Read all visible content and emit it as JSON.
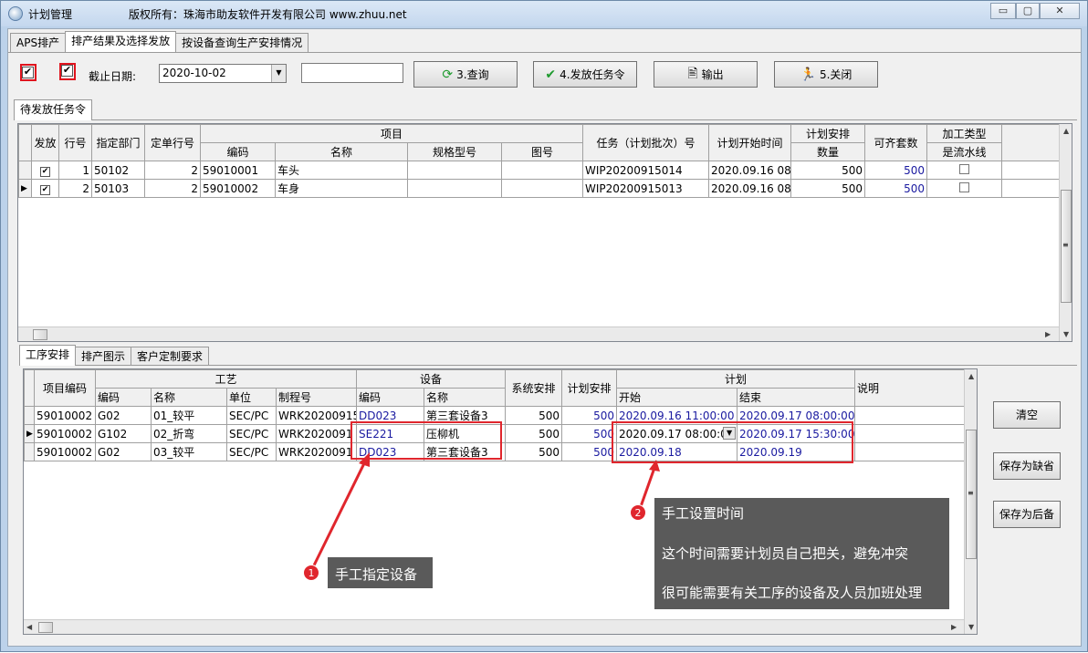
{
  "window": {
    "title": "计划管理",
    "copyright": "版权所有：珠海市助友软件开发有限公司 www.zhuu.net",
    "minimize": "▭",
    "restore": "▢",
    "close": "✕"
  },
  "main_tabs": [
    "APS排产",
    "排产结果及选择发放",
    "按设备查询生产安排情况"
  ],
  "toolbar": {
    "check1": "✔",
    "check2": "✔",
    "date_label": "截止日期:",
    "date_value": "2020-10-02",
    "date_arrow": "▼",
    "search_value": "",
    "query_icon": "⟳",
    "query_label": "3.查询",
    "release_icon": "✔",
    "release_label": "4.发放任务令",
    "export_icon": "🖹",
    "export_label": "输出",
    "close_icon": "🏃",
    "close_label": "5.关闭"
  },
  "upper_tab": "待发放任务令",
  "upper_grid": {
    "headers": {
      "release": "发放",
      "line": "行号",
      "dept": "指定部门",
      "order_line": "定单行号",
      "item": "项目",
      "code": "编码",
      "name": "名称",
      "spec": "规格型号",
      "drawing": "图号",
      "task": "任务（计划批次）号",
      "start": "计划开始时间",
      "plan_qty_1": "计划安排",
      "plan_qty_2": "数量",
      "kit": "可齐套数",
      "proc_1": "加工类型",
      "proc_2": "是流水线"
    },
    "rows": [
      {
        "check": "✔",
        "line": "1",
        "dept": "50102",
        "order_line": "2",
        "code": "59010001",
        "name": "车头",
        "spec": "",
        "drawing": "",
        "task": "WIP20200915014",
        "start": "2020.09.16 08:0",
        "qty": "500",
        "kit": "500",
        "selector": ""
      },
      {
        "check": "✔",
        "line": "2",
        "dept": "50103",
        "order_line": "2",
        "code": "59010002",
        "name": "车身",
        "spec": "",
        "drawing": "",
        "task": "WIP20200915013",
        "start": "2020.09.16 08:0",
        "qty": "500",
        "kit": "500",
        "selector": "▶"
      }
    ]
  },
  "lower_tabs": [
    "工序安排",
    "排产图示",
    "客户定制要求"
  ],
  "lower_grid": {
    "headers": {
      "item_code": "项目编码",
      "craft": "工艺",
      "c_code": "编码",
      "c_name": "名称",
      "c_unit": "单位",
      "c_route": "制程号",
      "equip": "设备",
      "e_code": "编码",
      "e_name": "名称",
      "sys": "系统安排",
      "plan_qty": "计划安排",
      "plan": "计划",
      "p_start": "开始",
      "p_end": "结束",
      "note": "说明"
    },
    "rows": [
      {
        "selector": "",
        "item": "59010002",
        "code": "G02",
        "name": "01_较平",
        "unit": "SEC/PC",
        "route": "WRK20200915",
        "e_code": "DD023",
        "e_name": "第三套设备3",
        "sys": "500",
        "plan": "500",
        "start": "2020.09.16 11:00:00",
        "end": "2020.09.17 08:00:00",
        "note": ""
      },
      {
        "selector": "▶",
        "item": "59010002",
        "code": "G102",
        "name": "02_折弯",
        "unit": "SEC/PC",
        "route": "WRK2020091",
        "e_code": "SE221",
        "e_name": "压柳机",
        "sys": "500",
        "plan": "500",
        "start": "2020.09.17 08:00:00",
        "end": "2020.09.17 15:30:00",
        "note": ""
      },
      {
        "selector": "",
        "item": "59010002",
        "code": "G02",
        "name": "03_较平",
        "unit": "SEC/PC",
        "route": "WRK2020091",
        "e_code": "DD023",
        "e_name": "第三套设备3",
        "sys": "500",
        "plan": "500",
        "start": "2020.09.18",
        "end": "2020.09.19",
        "note": ""
      }
    ]
  },
  "side_buttons": {
    "clear": "清空",
    "save_default": "保存为缺省",
    "save_later": "保存为后备"
  },
  "callouts": {
    "c1_num": "1",
    "c1_text": "手工指定设备",
    "c2_num": "2",
    "c2_title": "手工设置时间",
    "c2_line1": "这个时间需要计划员自己把关，避免冲突",
    "c2_line2": "很可能需要有关工序的设备及人员加班处理"
  },
  "scroll": {
    "up": "▲",
    "down": "▼",
    "left": "◀",
    "right": "▶",
    "grip": "≡"
  }
}
